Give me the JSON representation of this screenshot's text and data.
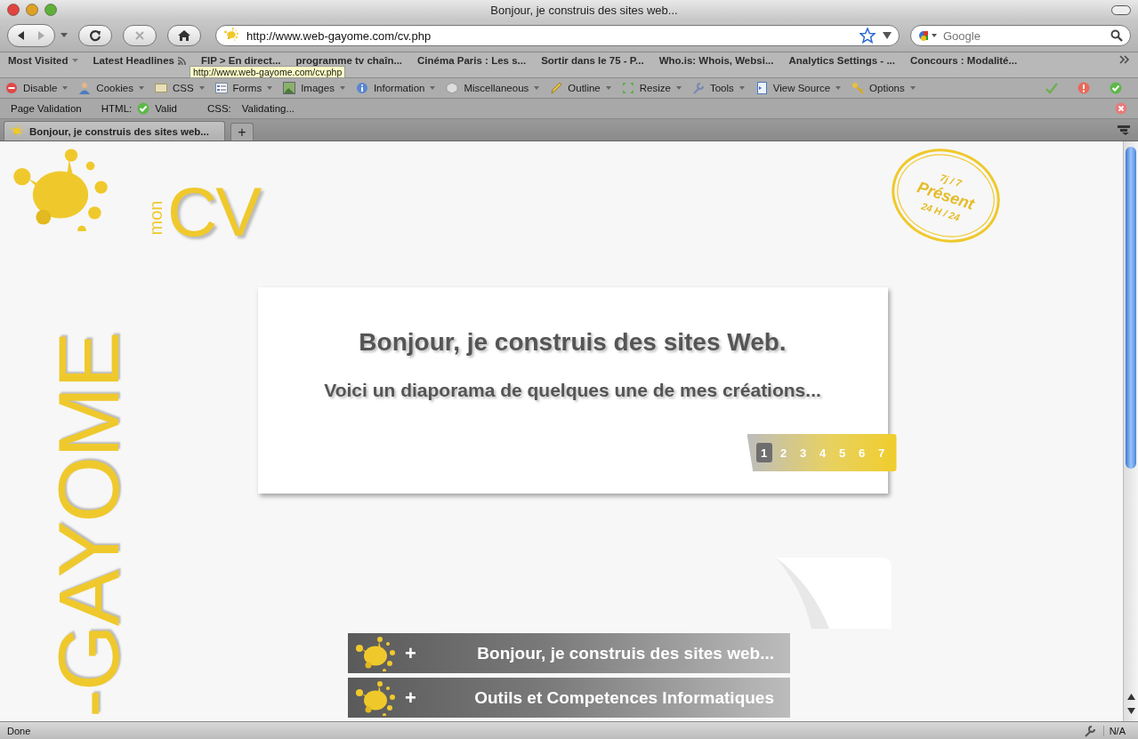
{
  "window": {
    "title": "Bonjour, je construis des sites web..."
  },
  "navigation": {
    "url": "http://www.web-gayome.com/cv.php",
    "search_placeholder": "Google"
  },
  "bookmarks": [
    {
      "label": "Most Visited",
      "kind": "menu"
    },
    {
      "label": "Latest Headlines",
      "kind": "feed"
    },
    {
      "label": "FIP > En direct...",
      "kind": "link"
    },
    {
      "label": "programme tv chaîn...",
      "kind": "link"
    },
    {
      "label": "Cinéma Paris : Les s...",
      "kind": "link"
    },
    {
      "label": "Sortir dans le 75 - P...",
      "kind": "link"
    },
    {
      "label": "Who.is: Whois, Websi...",
      "kind": "link"
    },
    {
      "label": "Analytics Settings - ...",
      "kind": "link"
    },
    {
      "label": "Concours : Modalité...",
      "kind": "link"
    }
  ],
  "tooltip": "http://www.web-gayome.com/cv.php",
  "developer_toolbar": [
    {
      "label": "Disable"
    },
    {
      "label": "Cookies"
    },
    {
      "label": "CSS"
    },
    {
      "label": "Forms"
    },
    {
      "label": "Images"
    },
    {
      "label": "Information"
    },
    {
      "label": "Miscellaneous"
    },
    {
      "label": "Outline"
    },
    {
      "label": "Resize"
    },
    {
      "label": "Tools"
    },
    {
      "label": "View Source"
    },
    {
      "label": "Options"
    }
  ],
  "validation_bar": {
    "title": "Page Validation",
    "html_label": "HTML:",
    "html_status": "Valid",
    "css_label": "CSS:",
    "css_status": "Validating..."
  },
  "tabs": [
    {
      "label": "Bonjour, je construis des sites web...",
      "selected": true
    }
  ],
  "new_tab": "+",
  "page": {
    "logo": {
      "small": "mon",
      "big": "CV"
    },
    "stamp": {
      "top": "7j / 7",
      "middle": "Présent",
      "bottom": "24 H / 24"
    },
    "side_logo": "-GAYOME",
    "slide": {
      "heading": "Bonjour, je construis des sites Web.",
      "subheading": "Voici un diaporama de quelques une de mes créations...",
      "pages": [
        {
          "label": "1",
          "selected": true
        },
        {
          "label": "2",
          "selected": false
        },
        {
          "label": "3",
          "selected": false
        },
        {
          "label": "4",
          "selected": false
        },
        {
          "label": "5",
          "selected": false
        },
        {
          "label": "6",
          "selected": false
        },
        {
          "label": "7",
          "selected": false
        }
      ]
    },
    "sections": [
      {
        "symbol": "+",
        "label": "Bonjour, je construis des sites web..."
      },
      {
        "symbol": "+",
        "label": "Outils et Competences Informatiques"
      }
    ]
  },
  "status_bar": {
    "text": "Done",
    "right": "N/A"
  }
}
